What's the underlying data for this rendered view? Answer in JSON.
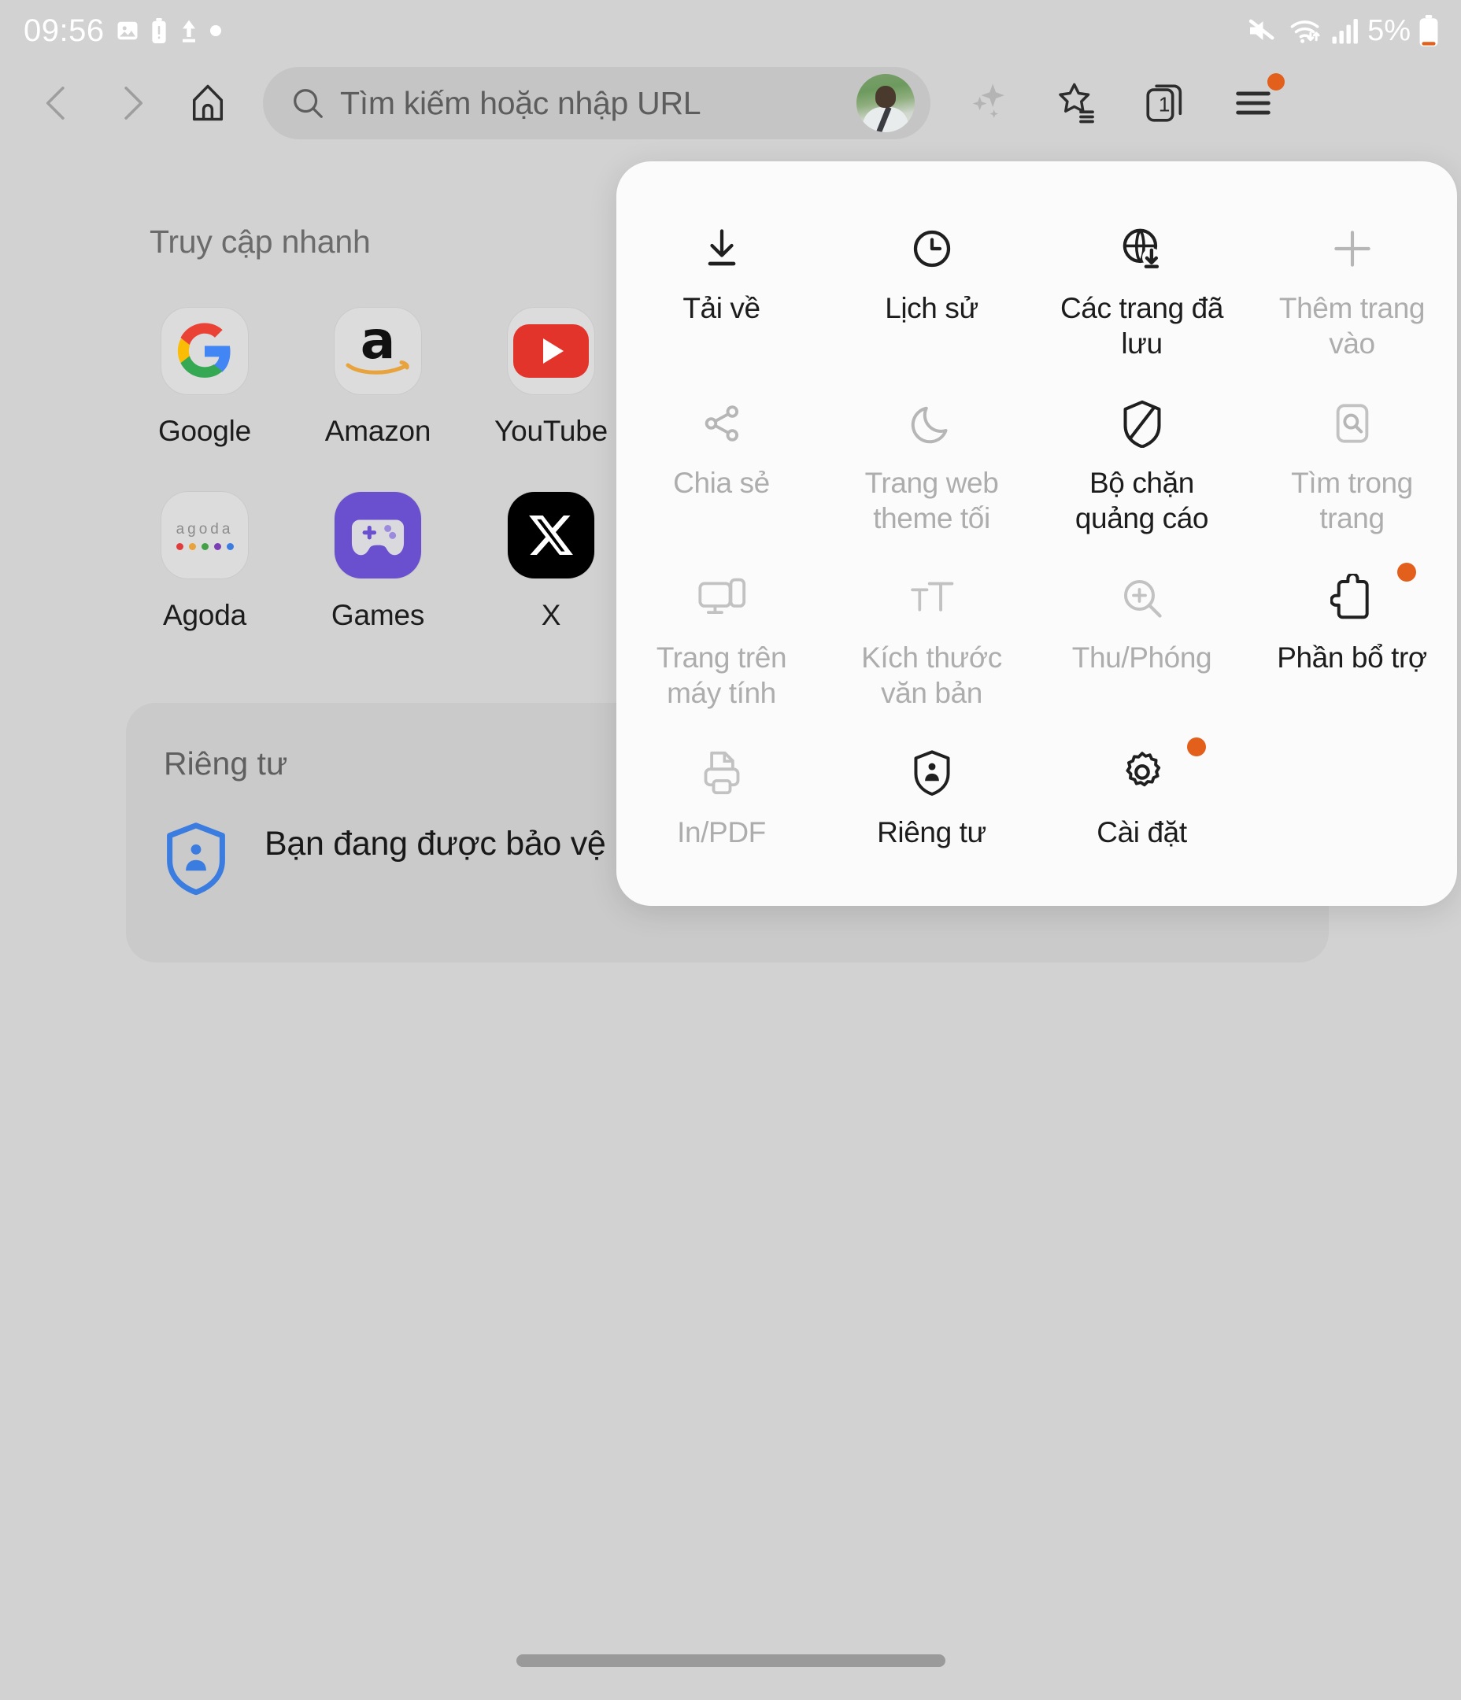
{
  "statusbar": {
    "time": "09:56",
    "battery_percent": "5%",
    "icons": [
      "image-icon",
      "battery-alert-icon",
      "upload-arrow-icon",
      "dot-icon"
    ],
    "right_icons": [
      "mute-icon",
      "wifi-transfer-icon",
      "signal-bars-icon",
      "battery-low-icon"
    ],
    "battery_accent": "#e2601b"
  },
  "toolbar": {
    "back_label": "back-navigation",
    "forward_label": "forward-navigation",
    "home_label": "home",
    "search_placeholder": "Tìm kiếm hoặc nhập URL",
    "tab_count": "1",
    "icons": [
      "chevron-left-icon",
      "chevron-right-icon",
      "home-icon",
      "search-icon",
      "avatar",
      "sparkle-icon",
      "bookmarks-star-icon",
      "tabs-icon",
      "menu-hamburger-icon"
    ],
    "menu_badge_color": "#e2601b"
  },
  "page": {
    "quick_access_title": "Truy cập nhanh",
    "shortcuts": [
      {
        "label": "Google",
        "icon": "google-logo"
      },
      {
        "label": "Amazon",
        "icon": "amazon-logo"
      },
      {
        "label": "YouTube",
        "icon": "youtube-logo"
      },
      {
        "label": "",
        "icon": "hidden-logo"
      },
      {
        "label": "Agoda",
        "icon": "agoda-logo"
      },
      {
        "label": "Games",
        "icon": "games-logo"
      },
      {
        "label": "X",
        "icon": "x-logo"
      },
      {
        "label": "",
        "icon": "hidden-logo"
      }
    ],
    "privacy": {
      "title": "Riêng tư",
      "message": "Bạn đang được bảo vệ khỏi trình theo dõi, pop-up và hơn thế nữa.",
      "icon": "privacy-shield-icon",
      "icon_color": "#3b7ce0"
    }
  },
  "popup_menu": {
    "items": [
      {
        "label": "Tải về",
        "icon": "download-icon",
        "enabled": true,
        "badge": false
      },
      {
        "label": "Lịch sử",
        "icon": "history-clock-icon",
        "enabled": true,
        "badge": false
      },
      {
        "label": "Các trang đã lưu",
        "icon": "saved-pages-globe-icon",
        "enabled": true,
        "badge": false
      },
      {
        "label": "Thêm trang vào",
        "icon": "plus-icon",
        "enabled": false,
        "badge": false
      },
      {
        "label": "Chia sẻ",
        "icon": "share-icon",
        "enabled": false,
        "badge": false
      },
      {
        "label": "Trang web theme tối",
        "icon": "moon-icon",
        "enabled": false,
        "badge": false
      },
      {
        "label": "Bộ chặn quảng cáo",
        "icon": "ad-blocker-shield-icon",
        "enabled": true,
        "badge": false
      },
      {
        "label": "Tìm trong trang",
        "icon": "find-in-page-icon",
        "enabled": false,
        "badge": false
      },
      {
        "label": "Trang trên máy tính",
        "icon": "desktop-site-icon",
        "enabled": false,
        "badge": false
      },
      {
        "label": "Kích thước văn bản",
        "icon": "text-size-icon",
        "enabled": false,
        "badge": false
      },
      {
        "label": "Thu/Phóng",
        "icon": "zoom-magnifier-icon",
        "enabled": false,
        "badge": false
      },
      {
        "label": "Phần bổ trợ",
        "icon": "extensions-puzzle-icon",
        "enabled": true,
        "badge": true
      },
      {
        "label": "In/PDF",
        "icon": "print-icon",
        "enabled": false,
        "badge": false
      },
      {
        "label": "Riêng tư",
        "icon": "privacy-shield-icon",
        "enabled": true,
        "badge": false
      },
      {
        "label": "Cài đặt",
        "icon": "settings-gear-icon",
        "enabled": true,
        "badge": true
      }
    ],
    "badge_color": "#e2601b"
  },
  "navbar": {
    "gesture_pill": "home-gesture-pill"
  }
}
